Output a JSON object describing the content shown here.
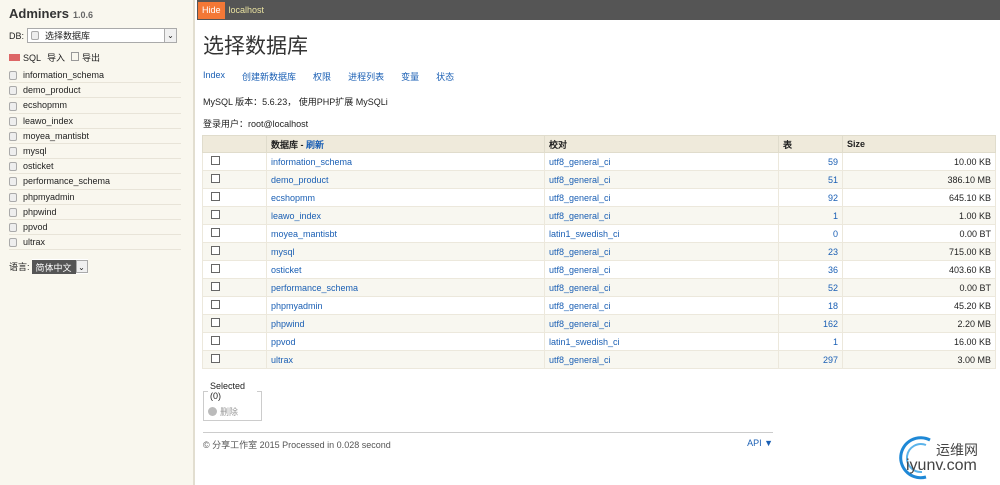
{
  "sidebar": {
    "app_name": "Adminers",
    "version": "1.0.6",
    "db_label": "DB:",
    "db_select": "选择数据库",
    "sql_label": "SQL",
    "import_label": "导入",
    "export_label": "导出",
    "databases": [
      "information_schema",
      "demo_product",
      "ecshopmm",
      "leawo_index",
      "moyea_mantisbt",
      "mysql",
      "osticket",
      "performance_schema",
      "phpmyadmin",
      "phpwind",
      "ppvod",
      "ultrax"
    ],
    "lang_label": "语言:",
    "lang_value": "简体中文"
  },
  "topbar": {
    "hide": "Hide",
    "host": "localhost"
  },
  "page_title": "选择数据库",
  "nav": [
    "Index",
    "创建新数据库",
    "权限",
    "进程列表",
    "变量",
    "状态"
  ],
  "version_info": "MySQL 版本：5.6.23， 使用PHP扩展 MySQLi",
  "user_info": "登录用户：root@localhost",
  "table": {
    "headers": {
      "db": "数据库",
      "refresh": "刷新",
      "sep": " - ",
      "collation": "校对",
      "tables": "表",
      "size": "Size"
    },
    "rows": [
      {
        "name": "information_schema",
        "collation": "utf8_general_ci",
        "tables": "59",
        "size": "10.00 KB"
      },
      {
        "name": "demo_product",
        "collation": "utf8_general_ci",
        "tables": "51",
        "size": "386.10 MB"
      },
      {
        "name": "ecshopmm",
        "collation": "utf8_general_ci",
        "tables": "92",
        "size": "645.10 KB"
      },
      {
        "name": "leawo_index",
        "collation": "utf8_general_ci",
        "tables": "1",
        "size": "1.00 KB"
      },
      {
        "name": "moyea_mantisbt",
        "collation": "latin1_swedish_ci",
        "tables": "0",
        "size": "0.00 BT"
      },
      {
        "name": "mysql",
        "collation": "utf8_general_ci",
        "tables": "23",
        "size": "715.00 KB"
      },
      {
        "name": "osticket",
        "collation": "utf8_general_ci",
        "tables": "36",
        "size": "403.60 KB"
      },
      {
        "name": "performance_schema",
        "collation": "utf8_general_ci",
        "tables": "52",
        "size": "0.00 BT"
      },
      {
        "name": "phpmyadmin",
        "collation": "utf8_general_ci",
        "tables": "18",
        "size": "45.20 KB"
      },
      {
        "name": "phpwind",
        "collation": "utf8_general_ci",
        "tables": "162",
        "size": "2.20 MB"
      },
      {
        "name": "ppvod",
        "collation": "latin1_swedish_ci",
        "tables": "1",
        "size": "16.00 KB"
      },
      {
        "name": "ultrax",
        "collation": "utf8_general_ci",
        "tables": "297",
        "size": "3.00 MB"
      }
    ]
  },
  "selected": {
    "legend": "Selected (0)",
    "delete": "删除"
  },
  "footer": {
    "text": "© 分享工作室 2015 Processed in 0.028 second",
    "api": "API ▼"
  },
  "watermark": {
    "cn": "运维网",
    "en": "iyunv.com"
  }
}
